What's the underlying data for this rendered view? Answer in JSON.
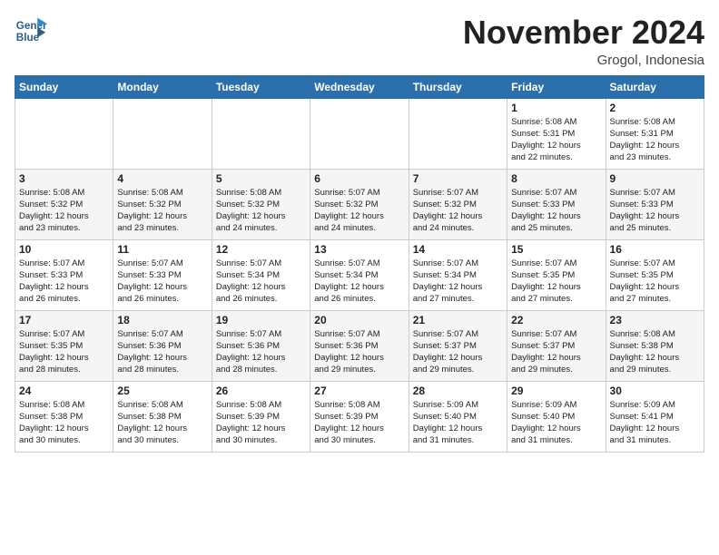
{
  "header": {
    "logo_line1": "General",
    "logo_line2": "Blue",
    "month": "November 2024",
    "location": "Grogol, Indonesia"
  },
  "weekdays": [
    "Sunday",
    "Monday",
    "Tuesday",
    "Wednesday",
    "Thursday",
    "Friday",
    "Saturday"
  ],
  "weeks": [
    [
      {
        "day": "",
        "info": ""
      },
      {
        "day": "",
        "info": ""
      },
      {
        "day": "",
        "info": ""
      },
      {
        "day": "",
        "info": ""
      },
      {
        "day": "",
        "info": ""
      },
      {
        "day": "1",
        "info": "Sunrise: 5:08 AM\nSunset: 5:31 PM\nDaylight: 12 hours\nand 22 minutes."
      },
      {
        "day": "2",
        "info": "Sunrise: 5:08 AM\nSunset: 5:31 PM\nDaylight: 12 hours\nand 23 minutes."
      }
    ],
    [
      {
        "day": "3",
        "info": "Sunrise: 5:08 AM\nSunset: 5:32 PM\nDaylight: 12 hours\nand 23 minutes."
      },
      {
        "day": "4",
        "info": "Sunrise: 5:08 AM\nSunset: 5:32 PM\nDaylight: 12 hours\nand 23 minutes."
      },
      {
        "day": "5",
        "info": "Sunrise: 5:08 AM\nSunset: 5:32 PM\nDaylight: 12 hours\nand 24 minutes."
      },
      {
        "day": "6",
        "info": "Sunrise: 5:07 AM\nSunset: 5:32 PM\nDaylight: 12 hours\nand 24 minutes."
      },
      {
        "day": "7",
        "info": "Sunrise: 5:07 AM\nSunset: 5:32 PM\nDaylight: 12 hours\nand 24 minutes."
      },
      {
        "day": "8",
        "info": "Sunrise: 5:07 AM\nSunset: 5:33 PM\nDaylight: 12 hours\nand 25 minutes."
      },
      {
        "day": "9",
        "info": "Sunrise: 5:07 AM\nSunset: 5:33 PM\nDaylight: 12 hours\nand 25 minutes."
      }
    ],
    [
      {
        "day": "10",
        "info": "Sunrise: 5:07 AM\nSunset: 5:33 PM\nDaylight: 12 hours\nand 26 minutes."
      },
      {
        "day": "11",
        "info": "Sunrise: 5:07 AM\nSunset: 5:33 PM\nDaylight: 12 hours\nand 26 minutes."
      },
      {
        "day": "12",
        "info": "Sunrise: 5:07 AM\nSunset: 5:34 PM\nDaylight: 12 hours\nand 26 minutes."
      },
      {
        "day": "13",
        "info": "Sunrise: 5:07 AM\nSunset: 5:34 PM\nDaylight: 12 hours\nand 26 minutes."
      },
      {
        "day": "14",
        "info": "Sunrise: 5:07 AM\nSunset: 5:34 PM\nDaylight: 12 hours\nand 27 minutes."
      },
      {
        "day": "15",
        "info": "Sunrise: 5:07 AM\nSunset: 5:35 PM\nDaylight: 12 hours\nand 27 minutes."
      },
      {
        "day": "16",
        "info": "Sunrise: 5:07 AM\nSunset: 5:35 PM\nDaylight: 12 hours\nand 27 minutes."
      }
    ],
    [
      {
        "day": "17",
        "info": "Sunrise: 5:07 AM\nSunset: 5:35 PM\nDaylight: 12 hours\nand 28 minutes."
      },
      {
        "day": "18",
        "info": "Sunrise: 5:07 AM\nSunset: 5:36 PM\nDaylight: 12 hours\nand 28 minutes."
      },
      {
        "day": "19",
        "info": "Sunrise: 5:07 AM\nSunset: 5:36 PM\nDaylight: 12 hours\nand 28 minutes."
      },
      {
        "day": "20",
        "info": "Sunrise: 5:07 AM\nSunset: 5:36 PM\nDaylight: 12 hours\nand 29 minutes."
      },
      {
        "day": "21",
        "info": "Sunrise: 5:07 AM\nSunset: 5:37 PM\nDaylight: 12 hours\nand 29 minutes."
      },
      {
        "day": "22",
        "info": "Sunrise: 5:07 AM\nSunset: 5:37 PM\nDaylight: 12 hours\nand 29 minutes."
      },
      {
        "day": "23",
        "info": "Sunrise: 5:08 AM\nSunset: 5:38 PM\nDaylight: 12 hours\nand 29 minutes."
      }
    ],
    [
      {
        "day": "24",
        "info": "Sunrise: 5:08 AM\nSunset: 5:38 PM\nDaylight: 12 hours\nand 30 minutes."
      },
      {
        "day": "25",
        "info": "Sunrise: 5:08 AM\nSunset: 5:38 PM\nDaylight: 12 hours\nand 30 minutes."
      },
      {
        "day": "26",
        "info": "Sunrise: 5:08 AM\nSunset: 5:39 PM\nDaylight: 12 hours\nand 30 minutes."
      },
      {
        "day": "27",
        "info": "Sunrise: 5:08 AM\nSunset: 5:39 PM\nDaylight: 12 hours\nand 30 minutes."
      },
      {
        "day": "28",
        "info": "Sunrise: 5:09 AM\nSunset: 5:40 PM\nDaylight: 12 hours\nand 31 minutes."
      },
      {
        "day": "29",
        "info": "Sunrise: 5:09 AM\nSunset: 5:40 PM\nDaylight: 12 hours\nand 31 minutes."
      },
      {
        "day": "30",
        "info": "Sunrise: 5:09 AM\nSunset: 5:41 PM\nDaylight: 12 hours\nand 31 minutes."
      }
    ]
  ]
}
